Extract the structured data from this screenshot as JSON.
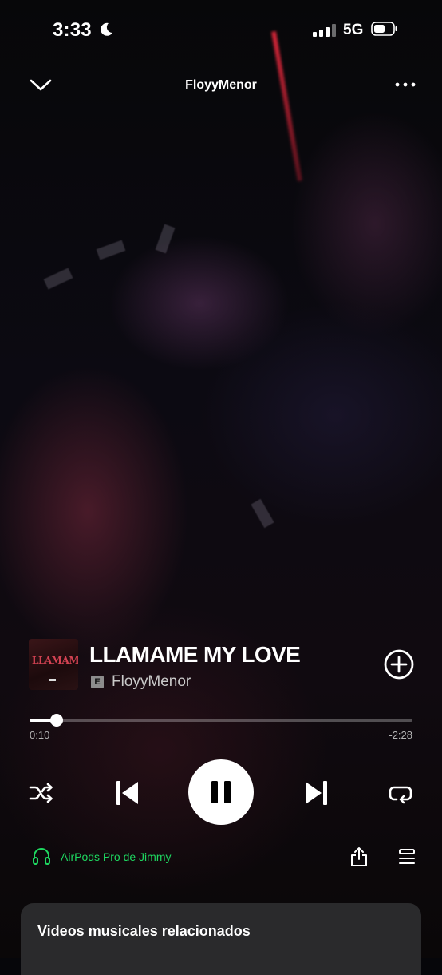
{
  "status_bar": {
    "time": "3:33",
    "network": "5G"
  },
  "header": {
    "title": "FloyyMenor"
  },
  "track": {
    "cover_text": "LLAMAME",
    "title": "LLAMAME MY LOVE",
    "explicit_badge": "E",
    "artist": "FloyyMenor"
  },
  "progress": {
    "elapsed": "0:10",
    "remaining": "-2:28",
    "fraction": 0.07
  },
  "device": {
    "label": "AirPods Pro de Jimmy"
  },
  "related": {
    "title": "Videos musicales relacionados"
  },
  "colors": {
    "accent": "#1ed760",
    "background": "#06060a",
    "card": "#2a2a2c"
  },
  "icons": [
    "moon-icon",
    "battery-icon",
    "chevron-down-icon",
    "more-icon",
    "add-circle-icon",
    "shuffle-icon",
    "previous-icon",
    "pause-icon",
    "next-icon",
    "repeat-icon",
    "headphones-icon",
    "share-icon",
    "queue-icon"
  ]
}
